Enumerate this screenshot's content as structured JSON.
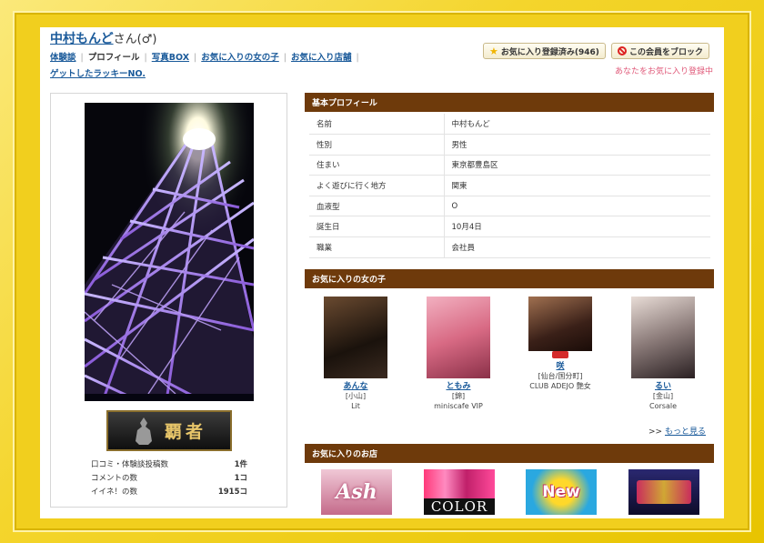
{
  "user": {
    "name": "中村もんど",
    "suffix": "さん(♂)"
  },
  "nav": [
    {
      "label": "体験談",
      "link": true
    },
    {
      "label": "プロフィール",
      "link": false
    },
    {
      "label": "写真BOX",
      "link": true
    },
    {
      "label": "お気に入りの女の子",
      "link": true
    },
    {
      "label": "お気に入り店舗",
      "link": true
    },
    {
      "label": "ゲットしたラッキーNO.",
      "link": true
    }
  ],
  "actions": {
    "favorite_label": "お気に入り登録済み(946)",
    "block_label": "この会員をブロック",
    "favorite_note": "あなたをお気に入り登録中"
  },
  "badge": {
    "text": "覇者"
  },
  "stats": [
    {
      "label": "口コミ・体験談投稿数",
      "value": "1件"
    },
    {
      "label": "コメントの数",
      "value": "1コ"
    },
    {
      "label": "イイネ！の数",
      "value": "1915コ"
    }
  ],
  "profile": {
    "heading": "基本プロフィール",
    "rows": [
      {
        "key": "名前",
        "value": "中村もんど"
      },
      {
        "key": "性別",
        "value": "男性"
      },
      {
        "key": "住まい",
        "value": "東京都豊島区"
      },
      {
        "key": "よく遊びに行く地方",
        "value": "関東"
      },
      {
        "key": "血液型",
        "value": "O"
      },
      {
        "key": "誕生日",
        "value": "10月4日"
      },
      {
        "key": "職業",
        "value": "会社員"
      }
    ]
  },
  "fav_girls": {
    "heading": "お気に入りの女の子",
    "items": [
      {
        "name": "あんな",
        "area": "[小山]",
        "shop": "Lit",
        "color": "#3a2418"
      },
      {
        "name": "ともみ",
        "area": "[錦]",
        "shop": "miniscafe VIP",
        "color": "#d86a84"
      },
      {
        "name": "咲",
        "area": "[仙台/国分町]",
        "shop": "CLUB ADEJO 艶女",
        "color": "#6b4030"
      },
      {
        "name": "るい",
        "area": "[金山]",
        "shop": "Corsale",
        "color": "#8a7a78"
      }
    ],
    "more_prefix": ">>",
    "more_label": "もっと見る"
  },
  "fav_shops": {
    "heading": "お気に入りのお店",
    "items": [
      {
        "text": "Ash",
        "bg": "#d98aa6"
      },
      {
        "text": "COLOR",
        "bg": "#111111"
      },
      {
        "text": "New",
        "bg": "#2aa8e0"
      },
      {
        "text": "",
        "bg": "#1b1840"
      }
    ]
  },
  "colors": {
    "header_brown": "#6e3a0b",
    "link_blue": "#1a5a9a",
    "note_pink": "#e05a7a",
    "frame_yellow": "#f1cf1e"
  }
}
